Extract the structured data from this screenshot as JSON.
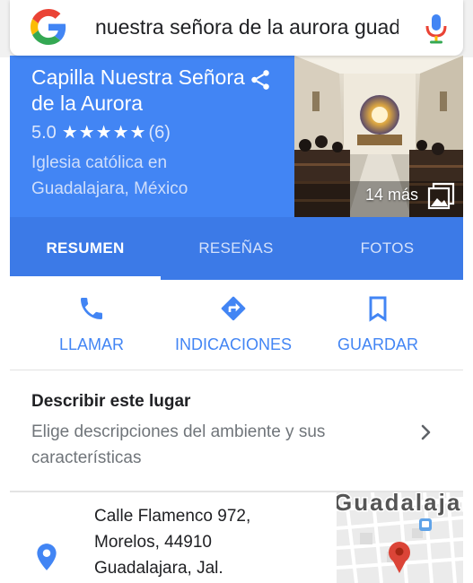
{
  "search": {
    "query": "nuestra señora de la aurora guadalajara"
  },
  "place": {
    "name": "Capilla Nuestra Señora de la Aurora",
    "rating": "5.0",
    "stars": "★★★★★",
    "review_count": "(6)",
    "category_line1": "Iglesia católica en",
    "category_line2": "Guadalajara, México",
    "photo_count": "14 más"
  },
  "tabs": [
    {
      "label": "RESUMEN",
      "active": true
    },
    {
      "label": "RESEÑAS",
      "active": false
    },
    {
      "label": "FOTOS",
      "active": false
    }
  ],
  "actions": [
    {
      "label": "LLAMAR",
      "icon": "phone-icon"
    },
    {
      "label": "INDICACIONES",
      "icon": "directions-icon"
    },
    {
      "label": "GUARDAR",
      "icon": "bookmark-icon"
    }
  ],
  "describe": {
    "title": "Describir este lugar",
    "subtitle": "Elige descripciones del ambiente y sus características"
  },
  "address": {
    "line1": "Calle Flamenco 972,",
    "line2": "Morelos, 44910",
    "line3": "Guadalajara, Jal."
  },
  "map": {
    "label": "Guadalajara"
  },
  "colors": {
    "brand_blue": "#4285f4",
    "tab_bar": "#3c7ae7",
    "map_pin": "#db4437"
  }
}
